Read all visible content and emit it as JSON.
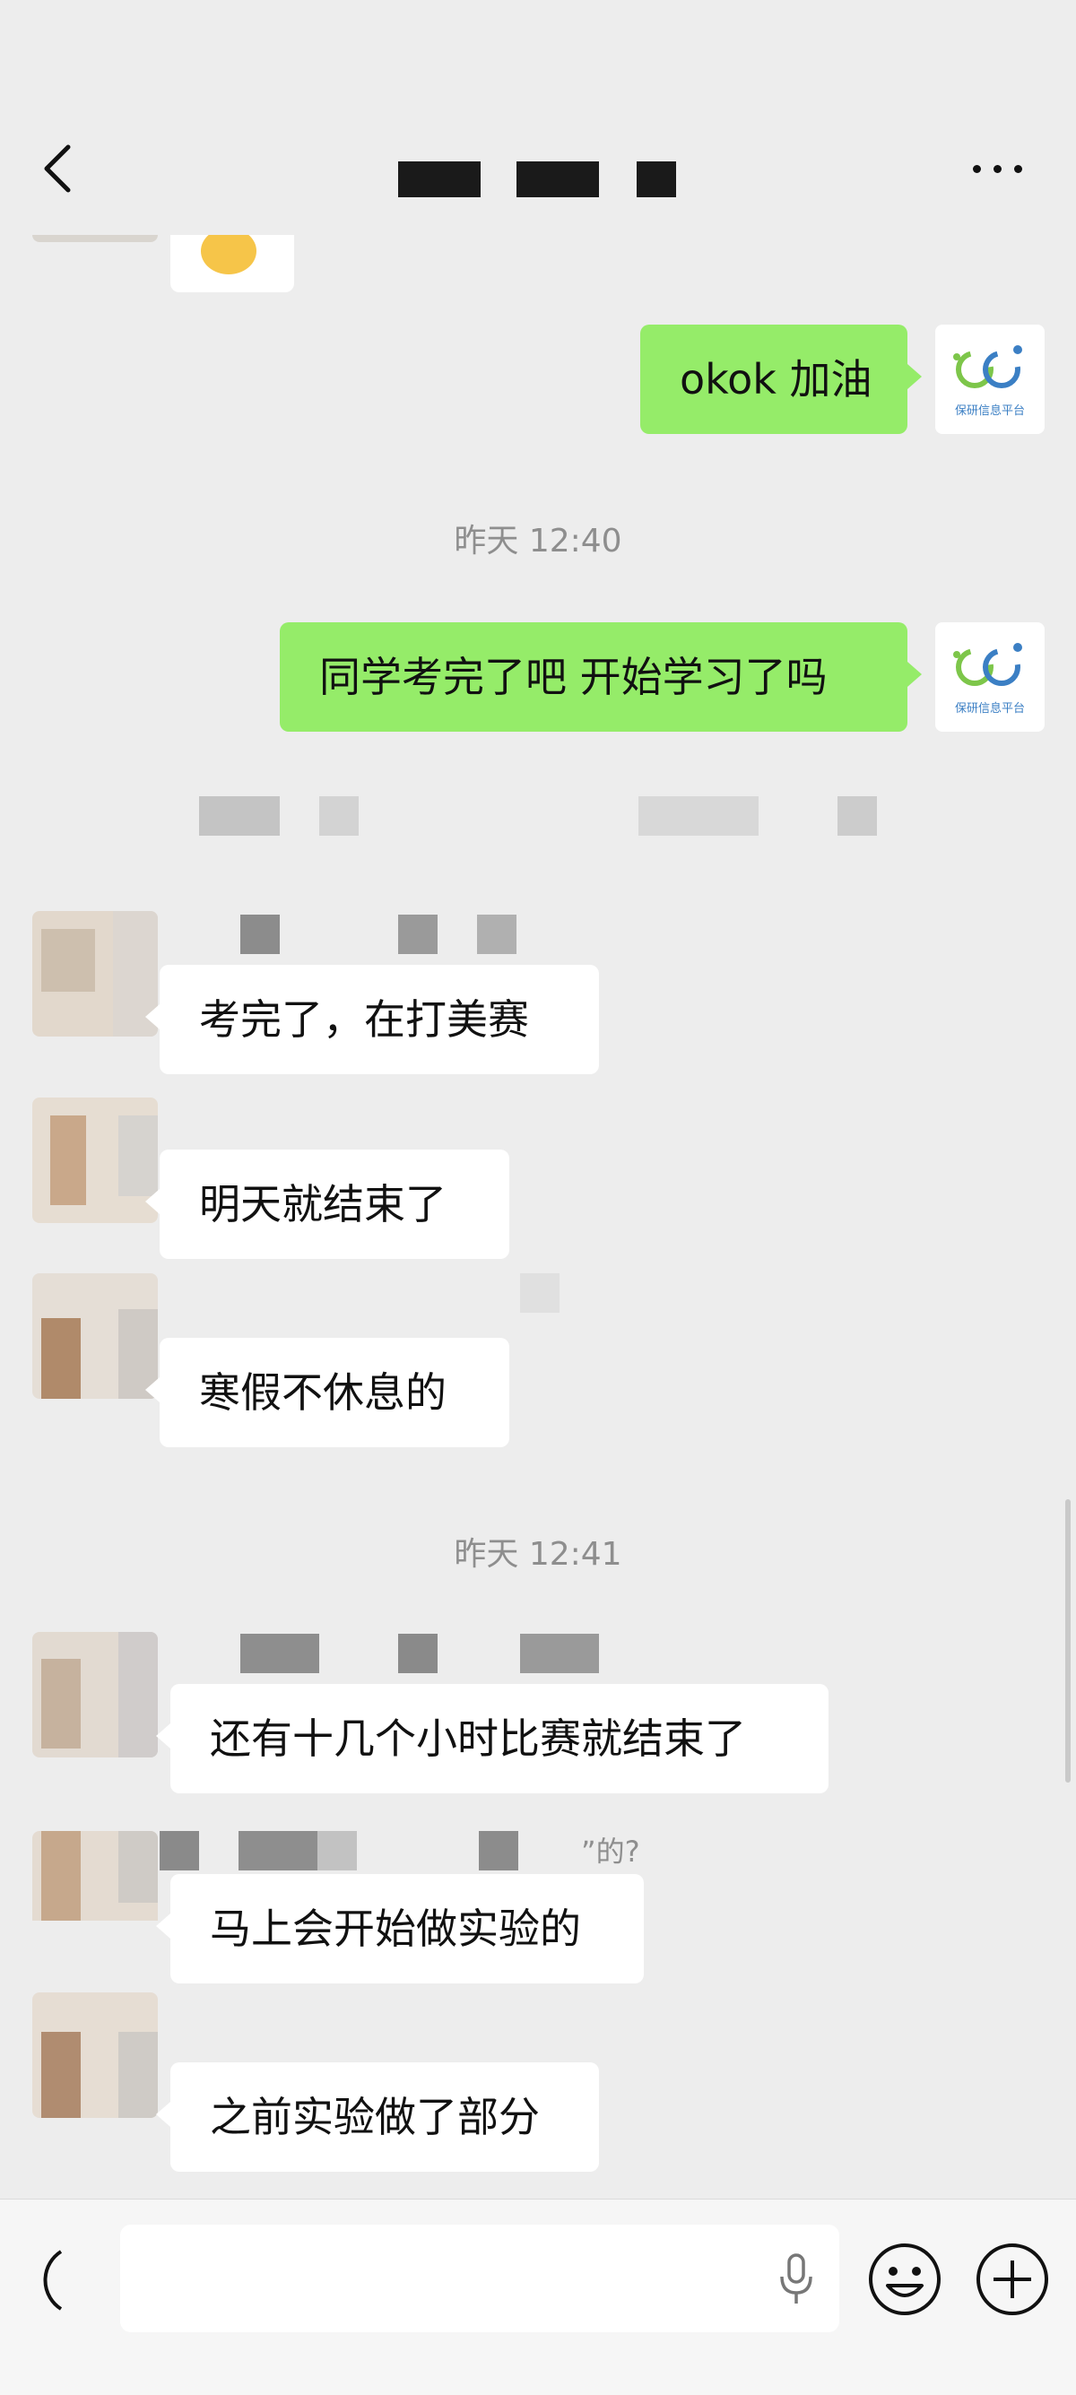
{
  "header": {
    "title": "",
    "back_icon": "chevron-left-icon",
    "more_icon": "more-dots-icon"
  },
  "messages": {
    "m1": {
      "text": "okok 加油"
    },
    "t1": {
      "text": "昨天 12:40"
    },
    "m2": {
      "text": "同学考完了吧 开始学习了吗"
    },
    "r1": {
      "text": "考完了，在打美赛"
    },
    "r2": {
      "text": "明天就结束了"
    },
    "r3": {
      "text": "寒假不休息的"
    },
    "t2": {
      "text": "昨天 12:41"
    },
    "r4": {
      "text": "还有十几个小时比赛就结束了"
    },
    "r5_name": {
      "text": "”的?"
    },
    "r5": {
      "text": "马上会开始做实验的"
    },
    "r6": {
      "text": "之前实验做了部分"
    }
  },
  "my_avatar": {
    "label": "保研信息平台"
  },
  "composer": {
    "placeholder": "",
    "value": ""
  },
  "colors": {
    "sent_bubble": "#95ec69",
    "received_bubble": "#ffffff",
    "background": "#ededed"
  }
}
